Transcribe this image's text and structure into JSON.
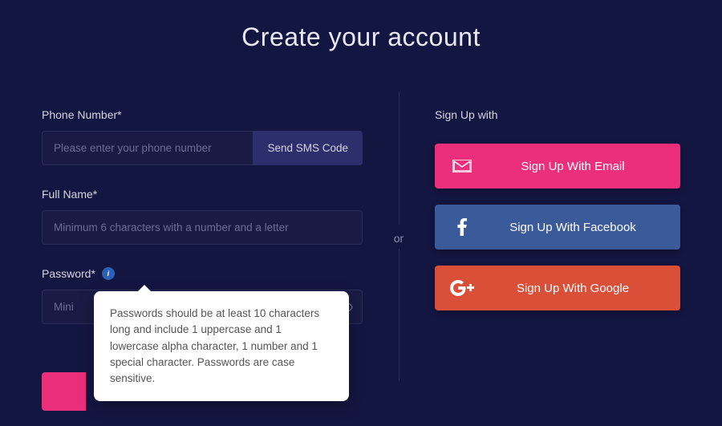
{
  "title": "Create your account",
  "form": {
    "phone_label": "Phone Number*",
    "phone_placeholder": "Please enter your phone number",
    "sms_button": "Send SMS Code",
    "name_label": "Full Name*",
    "name_placeholder": "Minimum 6 characters with a number and a letter",
    "password_label": "Password*",
    "password_placeholder": "Mini",
    "password_tooltip": "Passwords should be at least 10 characters long and include 1 uppercase and 1 lowercase alpha character, 1 number and 1 special character. Passwords are case sensitive."
  },
  "divider": "or",
  "signup": {
    "heading": "Sign Up with",
    "email_prefix": "Sign Up ",
    "email_suffix": "With Email",
    "facebook_prefix": "Sign Up ",
    "facebook_suffix": "With Facebook",
    "google_prefix": "Sign Up ",
    "google_suffix": "With Google"
  }
}
